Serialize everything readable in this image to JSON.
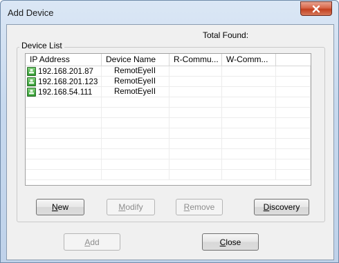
{
  "window": {
    "title": "Add Device"
  },
  "group": {
    "label": "Device List",
    "total_found_label": "Total Found:"
  },
  "list": {
    "columns": [
      "IP Address",
      "Device Name",
      "R-Commu...",
      "W-Comm...",
      ""
    ],
    "rows": [
      {
        "ip": "192.168.201.87",
        "name": "RemotEyeII",
        "r": "",
        "w": ""
      },
      {
        "ip": "192.168.201.123",
        "name": "RemotEyeII",
        "r": "",
        "w": ""
      },
      {
        "ip": "192.168.54.111",
        "name": "RemotEyeII",
        "r": "",
        "w": ""
      }
    ],
    "device_icon": "network-device-icon"
  },
  "buttons": {
    "new": {
      "pre": "",
      "key": "N",
      "post": "ew",
      "enabled": true
    },
    "modify": {
      "pre": "",
      "key": "M",
      "post": "odify",
      "enabled": false
    },
    "remove": {
      "pre": "",
      "key": "R",
      "post": "emove",
      "enabled": false
    },
    "discovery": {
      "pre": "",
      "key": "D",
      "post": "iscovery",
      "enabled": true
    },
    "add": {
      "pre": "",
      "key": "A",
      "post": "dd",
      "enabled": false
    },
    "close": {
      "pre": "",
      "key": "C",
      "post": "lose",
      "enabled": true
    }
  },
  "colors": {
    "close_button": "#c7452a",
    "device_icon": "#2f9b2f"
  }
}
